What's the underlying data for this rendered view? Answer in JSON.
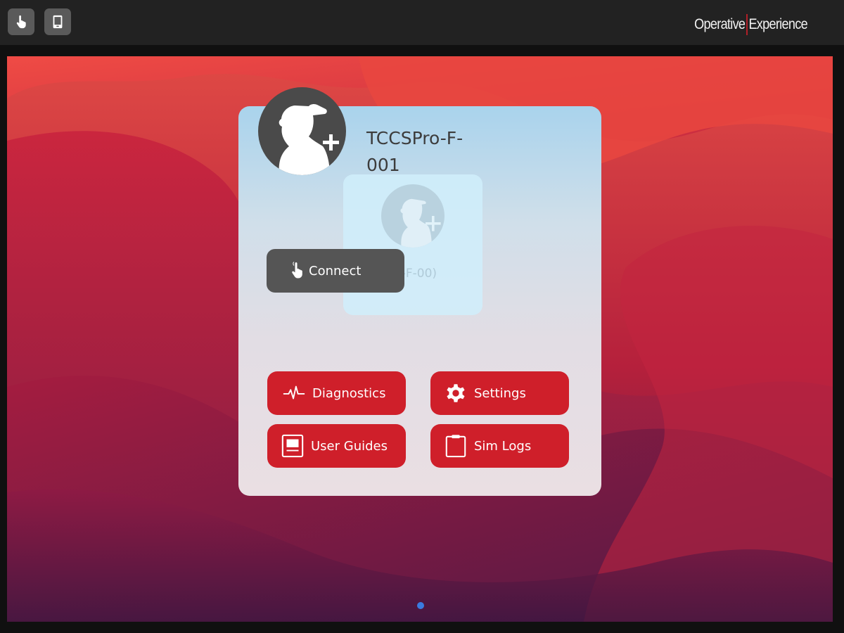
{
  "topbar": {
    "tool_icons": [
      "hand-pointer-icon",
      "tablet-icon"
    ],
    "brand_left": "Operative",
    "brand_right": "Experience",
    "brand_separator_color": "#c8202a"
  },
  "device": {
    "name": "TCCSPro-F-001",
    "ghost_label": "o-F-00)"
  },
  "actions": {
    "connect": "Connect",
    "diagnostics": "Diagnostics",
    "settings": "Settings",
    "user_guides": "User Guides",
    "sim_logs": "Sim Logs"
  },
  "colors": {
    "accent_red": "#cf1f2a",
    "connect_gray": "#555555",
    "page_indicator": "#3a7be0"
  },
  "pager": {
    "total": 1,
    "active": 1
  }
}
